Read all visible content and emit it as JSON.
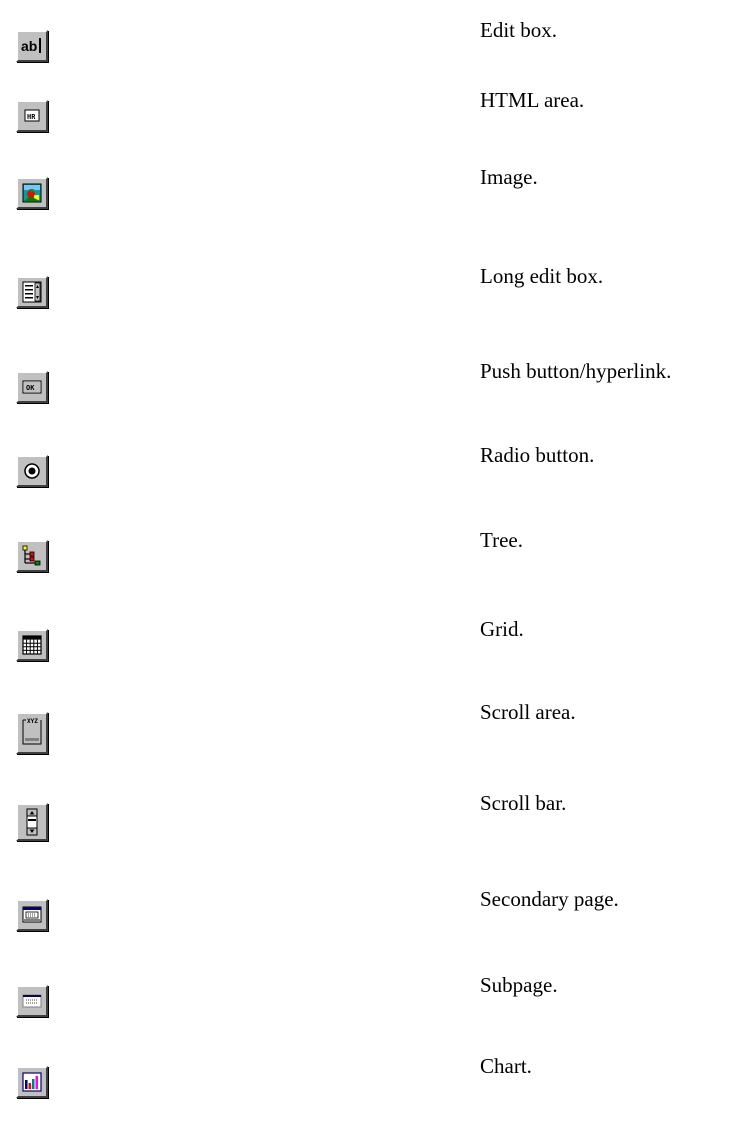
{
  "controls": [
    {
      "label": "Edit box.",
      "icon": "edit-box-icon"
    },
    {
      "label": "HTML area.",
      "icon": "html-area-icon"
    },
    {
      "label": "Image.",
      "icon": "image-icon"
    },
    {
      "label": "Long edit box.",
      "icon": "long-edit-box-icon"
    },
    {
      "label": "Push button/hyperlink.",
      "icon": "push-button-icon"
    },
    {
      "label": "Radio button.",
      "icon": "radio-button-icon"
    },
    {
      "label": "Tree.",
      "icon": "tree-icon"
    },
    {
      "label": "Grid.",
      "icon": "grid-icon"
    },
    {
      "label": "Scroll area.",
      "icon": "scroll-area-icon"
    },
    {
      "label": "Scroll bar.",
      "icon": "scroll-bar-icon"
    },
    {
      "label": "Secondary page.",
      "icon": "secondary-page-icon"
    },
    {
      "label": "Subpage.",
      "icon": "subpage-icon"
    },
    {
      "label": "Chart.",
      "icon": "chart-icon"
    }
  ],
  "colors": {
    "button_face": "#c0c0c0",
    "highlight": "#ffffff",
    "shadow": "#808080",
    "dark_shadow": "#404040",
    "navy": "#000080",
    "teal": "#008080"
  }
}
